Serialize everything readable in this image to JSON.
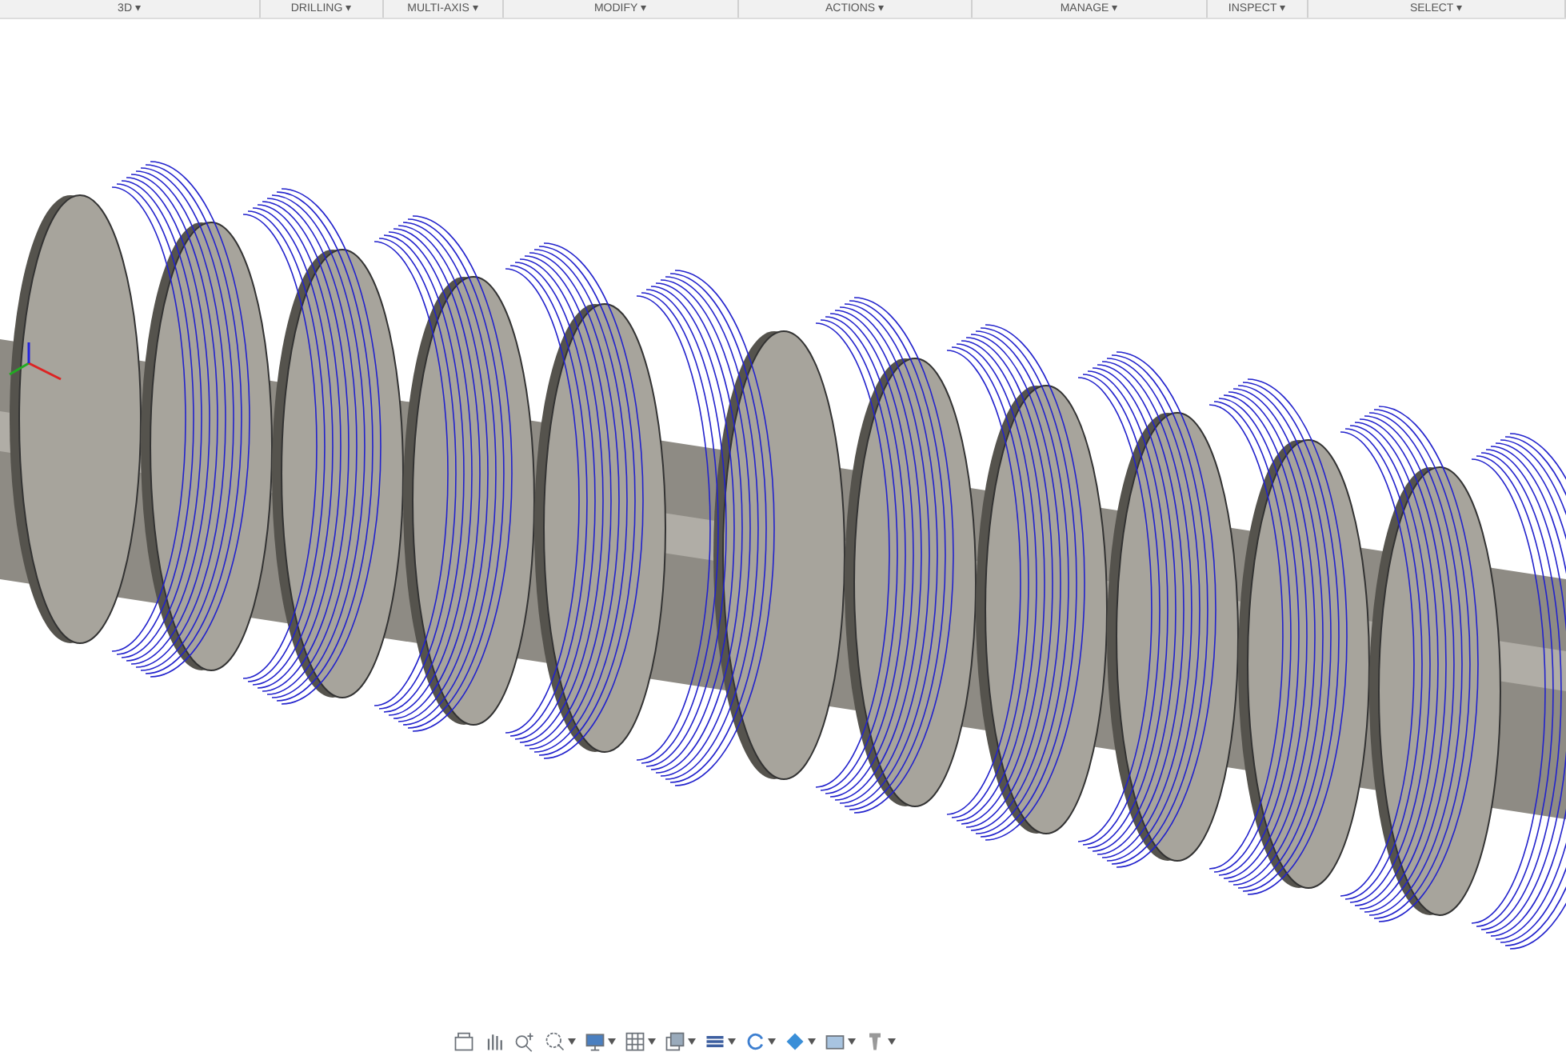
{
  "toolbar": {
    "groups": [
      {
        "label": "3D ▾"
      },
      {
        "label": "DRILLING ▾"
      },
      {
        "label": "MULTI-AXIS ▾"
      },
      {
        "label": "MODIFY ▾"
      },
      {
        "label": "ACTIONS ▾"
      },
      {
        "label": "MANAGE ▾"
      },
      {
        "label": "INSPECT ▾"
      },
      {
        "label": "SELECT ▾"
      }
    ]
  },
  "nav_bar": {
    "tools": [
      {
        "dropdown": false
      },
      {
        "dropdown": false
      },
      {
        "dropdown": false
      },
      {
        "dropdown": true
      },
      {
        "dropdown": true
      },
      {
        "dropdown": true
      },
      {
        "dropdown": true
      },
      {
        "dropdown": true
      },
      {
        "dropdown": true
      },
      {
        "dropdown": true
      },
      {
        "dropdown": true
      },
      {
        "dropdown": true
      }
    ]
  }
}
